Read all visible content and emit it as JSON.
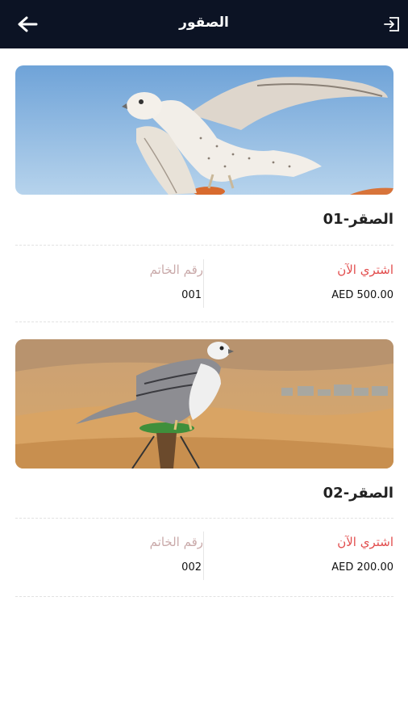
{
  "header": {
    "title": "الصقور",
    "back_icon": "arrow-left-icon",
    "logout_icon": "logout-icon"
  },
  "cards": [
    {
      "name": "الصقر-01",
      "buy_label": "اشتري الآن",
      "price": "AED 500.00",
      "ring_label": "رقم الخاتم",
      "ring_number": "001"
    },
    {
      "name": "الصقر-02",
      "buy_label": "اشتري الآن",
      "price": "AED 200.00",
      "ring_label": "رقم الخاتم",
      "ring_number": "002"
    }
  ],
  "colors": {
    "header_bg": "#0c1324",
    "buy_label": "#e24c4c",
    "ring_label": "#c9a9a9"
  }
}
